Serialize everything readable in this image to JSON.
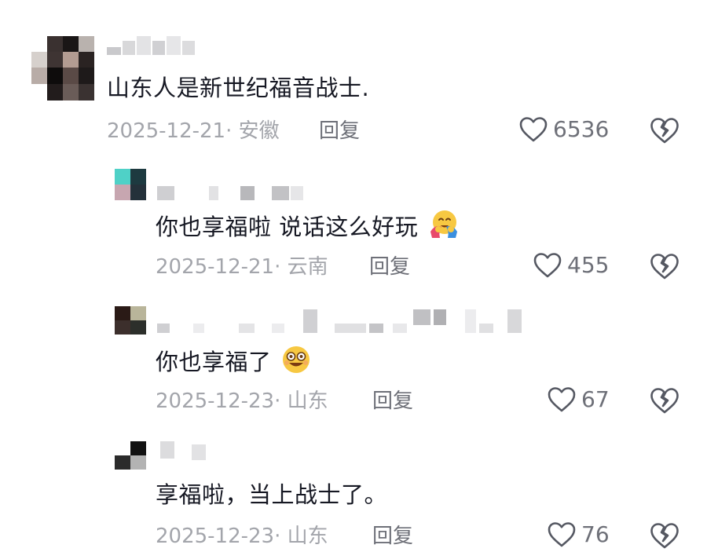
{
  "comments": [
    {
      "text": "山东人是新世纪福音战士.",
      "meta": "2025-12-21· 安徽",
      "reply_label": "回复",
      "likes": "6536"
    },
    {
      "text": "你也享福啦 说话这么好玩",
      "emoji": "hugging-face",
      "meta": "2025-12-21· 云南",
      "reply_label": "回复",
      "likes": "455"
    },
    {
      "text": "你也享福了",
      "emoji": "smiling-face",
      "meta": "2025-12-23· 山东",
      "reply_label": "回复",
      "likes": "67"
    },
    {
      "text": "享福啦，当上战士了。",
      "meta": "2025-12-23· 山东",
      "reply_label": "回复",
      "likes": "76"
    }
  ],
  "colors": {
    "text": "#161823",
    "meta": "#a3a5ab",
    "action": "#6e7078",
    "icon_stroke": "#555862"
  },
  "icons": {
    "like": "heart-outline-icon",
    "dislike": "broken-heart-icon"
  }
}
